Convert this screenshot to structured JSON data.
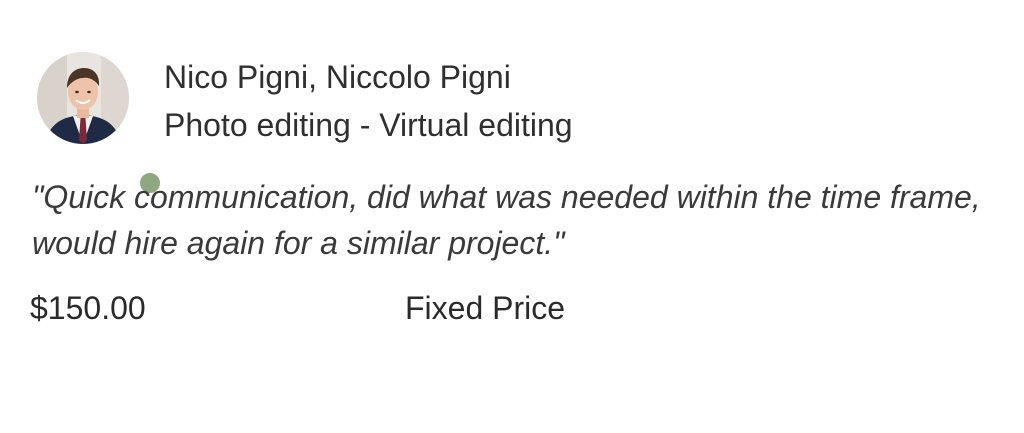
{
  "review": {
    "client_names": "Nico Pigni, Niccolo Pigni",
    "job_title": "Photo editing - Virtual editing",
    "quote": "\"Quick communication, did what was needed within the time frame, would hire again for a similar project.\"",
    "amount": "$150.00",
    "price_type": "Fixed Price",
    "status_color": "#8fa880"
  }
}
